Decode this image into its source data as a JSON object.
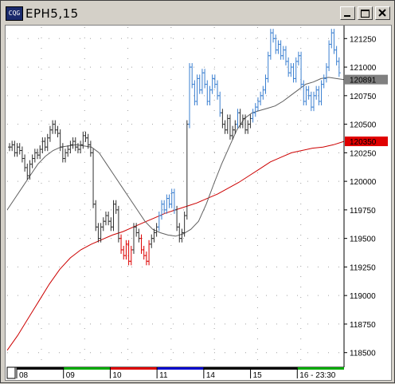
{
  "window": {
    "title": "EPH5,15",
    "icon": "cqg-logo-icon",
    "icon_text": "CQG"
  },
  "chart_data": {
    "type": "bar",
    "symbol": "EPH5",
    "interval_minutes": 15,
    "ylim": [
      118400,
      121350
    ],
    "y_ticks": [
      118500,
      118750,
      119000,
      119250,
      119500,
      119750,
      120000,
      120250,
      120500,
      120750,
      121000,
      121250
    ],
    "y_tick_labels": [
      "118500",
      "118750",
      "119000",
      "119250",
      "119500",
      "119750",
      "120000",
      "120250",
      "120500",
      "120750",
      "121000",
      "121250"
    ],
    "price_markers": [
      {
        "label": "120891",
        "value": 120891,
        "color": "#808080"
      },
      {
        "label": "120350",
        "value": 120350,
        "color": "#e00000"
      }
    ],
    "x_sessions": [
      {
        "label": "08",
        "color": "#000000"
      },
      {
        "label": "09",
        "color": "#00aa00"
      },
      {
        "label": "10",
        "color": "#dd0000"
      },
      {
        "label": "11",
        "color": "#0000cc"
      },
      {
        "label": "14",
        "color": "#000000"
      },
      {
        "label": "15",
        "color": "#000000"
      },
      {
        "label": "16 - 23:30",
        "color": "#00aa00"
      }
    ],
    "colors": {
      "up": "#3a7fd0",
      "down": "#dd0000",
      "neutral": "#303030",
      "ma_short": "#606060",
      "ma_long": "#cc0000",
      "grid": "#a0a0a0"
    },
    "bar_closes": [
      120300,
      120320,
      120250,
      120300,
      120270,
      120200,
      120120,
      120050,
      120150,
      120200,
      120250,
      120230,
      120280,
      120350,
      120300,
      120380,
      120450,
      120500,
      120450,
      120420,
      120300,
      120200,
      120250,
      120280,
      120320,
      120350,
      120300,
      120280,
      120320,
      120400,
      120380,
      120320,
      120250,
      119800,
      119600,
      119500,
      119600,
      119650,
      119700,
      119650,
      119600,
      119800,
      119750,
      119500,
      119400,
      119350,
      119450,
      119300,
      119400,
      119600,
      119550,
      119500,
      119400,
      119350,
      119300,
      119450,
      119500,
      119550,
      119600,
      119700,
      119800,
      119750,
      119850,
      119800,
      119900,
      119750,
      119600,
      119500,
      119550,
      119700,
      120500,
      121000,
      120850,
      120700,
      120900,
      120800,
      120950,
      120850,
      120700,
      120800,
      120900,
      120850,
      120750,
      120600,
      120500,
      120450,
      120550,
      120400,
      120450,
      120500,
      120600,
      120500,
      120550,
      120450,
      120500,
      120550,
      120600,
      120650,
      120700,
      120750,
      120800,
      120900,
      121100,
      121300,
      121250,
      121150,
      121200,
      121100,
      121150,
      121050,
      120950,
      121000,
      120900,
      121050,
      121100,
      120850,
      120700,
      120800,
      120750,
      120650,
      120750,
      120800,
      120700,
      120850,
      120900,
      121000,
      121200,
      121300,
      121150,
      121050,
      120950
    ],
    "ma_short_values": [
      119750,
      119850,
      119950,
      120050,
      120150,
      120220,
      120270,
      120300,
      120310,
      120320,
      120310,
      120300,
      120250,
      120150,
      120050,
      119950,
      119850,
      119750,
      119650,
      119580,
      119550,
      119530,
      119520,
      119540,
      119580,
      119650,
      119800,
      119980,
      120150,
      120300,
      120450,
      120550,
      120600,
      120620,
      120640,
      120660,
      120700,
      120750,
      120800,
      120850,
      120870,
      120900,
      120910,
      120900,
      120891
    ],
    "ma_long_values": [
      118520,
      118650,
      118800,
      118950,
      119100,
      119230,
      119330,
      119400,
      119450,
      119490,
      119530,
      119560,
      119600,
      119640,
      119680,
      119720,
      119750,
      119780,
      119810,
      119850,
      119890,
      119940,
      119990,
      120050,
      120110,
      120170,
      120210,
      120250,
      120270,
      120290,
      120300,
      120320,
      120350
    ]
  }
}
